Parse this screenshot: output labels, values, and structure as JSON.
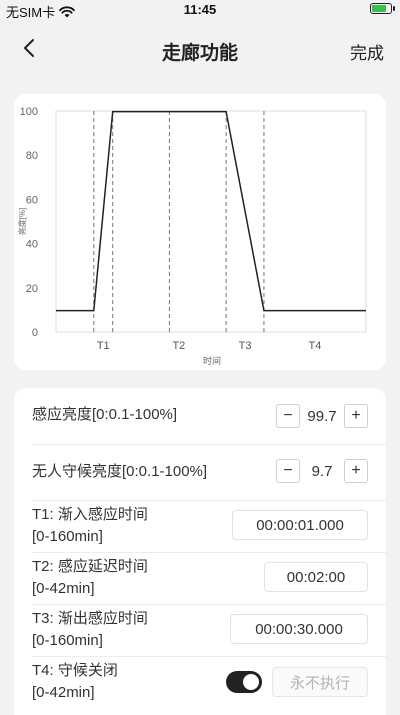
{
  "status_bar": {
    "carrier": "无SIM卡",
    "time": "11:45",
    "battery_level": 0.9,
    "battery_color": "#37c04a"
  },
  "nav": {
    "title": "走廊功能",
    "done_label": "完成",
    "back_icon": "chevron-left-icon"
  },
  "chart_data": {
    "type": "line",
    "ylabel": "亮度[%]",
    "xlabel": "时间",
    "ylim": [
      0,
      100
    ],
    "yticks": [
      "0",
      "20",
      "40",
      "60",
      "80",
      "100"
    ],
    "phase_labels": [
      "T1",
      "T2",
      "T3",
      "T4"
    ],
    "series": [
      {
        "x": [
          0,
          1,
          1.5,
          3,
          4.5,
          5.5,
          8.2
        ],
        "values": [
          9.7,
          9.7,
          99.7,
          99.7,
          99.7,
          9.7,
          9.7
        ]
      }
    ],
    "grid": false,
    "line_color": "#222222"
  },
  "settings": {
    "sensing_brightness": {
      "label": "感应亮度[0:0.1-100%]",
      "value": "99.7",
      "minus": "−",
      "plus": "+"
    },
    "standby_brightness": {
      "label": "无人守候亮度[0:0.1-100%]",
      "value": "9.7",
      "minus": "−",
      "plus": "+"
    },
    "t1": {
      "label_line1": "T1: 渐入感应时间",
      "label_line2": "[0-160min]",
      "value": "00:00:01.000"
    },
    "t2": {
      "label_line1": "T2: 感应延迟时间",
      "label_line2": "[0-42min]",
      "value": "00:02:00"
    },
    "t3": {
      "label_line1": "T3: 渐出感应时间",
      "label_line2": "[0-160min]",
      "value": "00:00:30.000"
    },
    "t4": {
      "label_line1": "T4: 守候关闭",
      "label_line2": "[0-42min]",
      "toggle_on": true,
      "value": "永不执行"
    }
  }
}
